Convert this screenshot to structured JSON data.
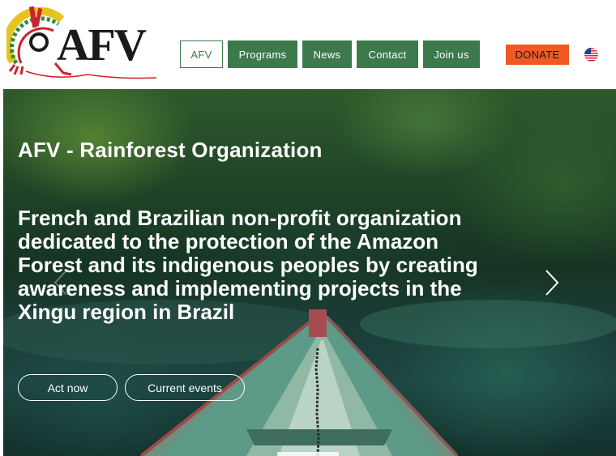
{
  "logo": {
    "text": "AFV"
  },
  "nav": {
    "items": [
      {
        "label": "AFV",
        "active": true
      },
      {
        "label": "Programs",
        "active": false
      },
      {
        "label": "News",
        "active": false
      },
      {
        "label": "Contact",
        "active": false
      },
      {
        "label": "Join us",
        "active": false
      }
    ]
  },
  "donate": {
    "label": "DONATE"
  },
  "language": {
    "icon": "us-flag-icon"
  },
  "hero": {
    "title": "AFV - Rainforest Organization",
    "description": "French and Brazilian non-profit organization dedicated to the protection of the Amazon Forest and its indigenous peoples by creating awareness and implementing projects in the Xingu region in Brazil",
    "buttons": {
      "act_now": "Act now",
      "current_events": "Current events"
    }
  },
  "colors": {
    "nav_green": "#3c7a4c",
    "donate_orange": "#ef5a24",
    "hero_text": "#ffffff"
  }
}
